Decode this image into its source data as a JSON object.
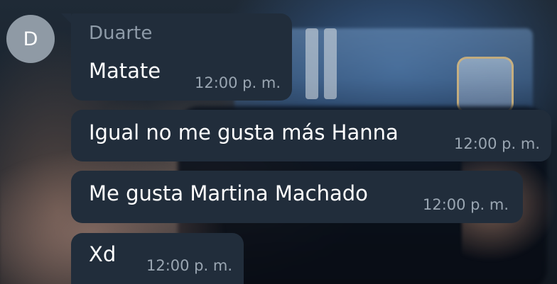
{
  "chat": {
    "avatar": {
      "initial": "D",
      "color": "#8f9aa5"
    },
    "bubble_color": "#212d3b",
    "messages": [
      {
        "sender": "Duarte",
        "text": "Matate",
        "time": "12:00 p. m."
      },
      {
        "text": "Igual no me gusta más Hanna",
        "time": "12:00 p. m."
      },
      {
        "text": "Me gusta Martina Machado",
        "time": "12:00 p. m."
      },
      {
        "text": "Xd",
        "time": "12:00 p. m."
      }
    ]
  }
}
